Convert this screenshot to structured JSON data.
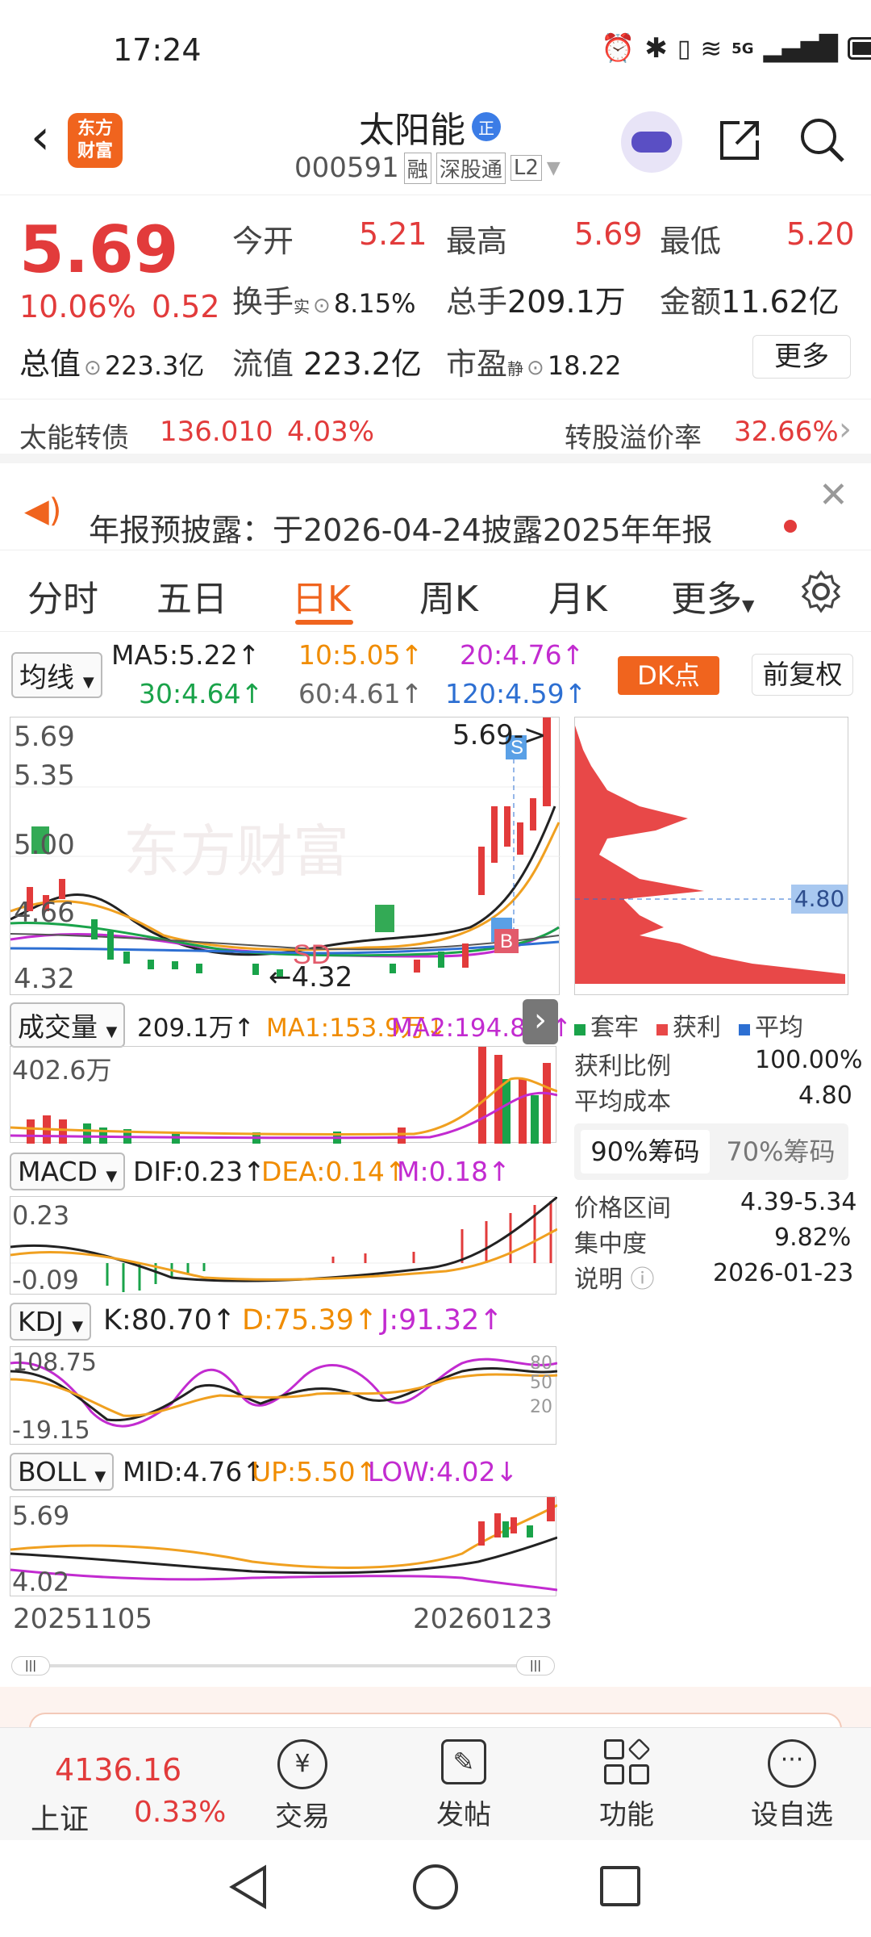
{
  "status": {
    "time": "17:24",
    "net": "5G"
  },
  "header": {
    "title": "太阳能",
    "badge": "正",
    "logo": "东方\n财富",
    "code": "000591",
    "tags": [
      "融",
      "深股通",
      "L2"
    ]
  },
  "quote": {
    "price": "5.69",
    "pct": "10.06%",
    "chg": "0.52",
    "open_label": "今开",
    "open": "5.21",
    "high_label": "最高",
    "high": "5.69",
    "low_label": "最低",
    "low": "5.20",
    "turnover_label": "换手",
    "turnover_sup": "实",
    "turnover": "8.15%",
    "vol_label": "总手",
    "vol": "209.1万",
    "amount_label": "金额",
    "amount": "11.62亿",
    "mktcap_label": "总值",
    "mktcap": "223.3亿",
    "float_label": "流值",
    "float": "223.2亿",
    "pe_label": "市盈",
    "pe_sup": "静",
    "pe": "18.22",
    "more": "更多"
  },
  "bond": {
    "name": "太能转债",
    "price": "136.010",
    "pct": "4.03%",
    "premium_label": "转股溢价率",
    "premium": "32.66%"
  },
  "notice": {
    "text": "年报预披露：于2026-04-24披露2025年年报"
  },
  "tabs": [
    "分时",
    "五日",
    "日K",
    "周K",
    "月K",
    "更多"
  ],
  "active_tab": "日K",
  "ma": {
    "selector": "均线",
    "ma5": "MA5:5.22↑",
    "ma10": "10:5.05↑",
    "ma20": "20:4.76↑",
    "ma30": "30:4.64↑",
    "ma60": "60:4.61↑",
    "ma120": "120:4.59↑",
    "dk": "DK点",
    "adjust": "前复权"
  },
  "kline": {
    "y_top": "5.69",
    "y2": "5.35",
    "y3": "5.00",
    "y4": "4.66",
    "y_bottom": "4.32",
    "high_marker": "5.69->",
    "low_marker": "4.32",
    "watermark": "东方财富"
  },
  "chips": {
    "avg_cost_marker": "4.80",
    "legend": [
      "套牢",
      "获利",
      "平均"
    ],
    "profit_label": "获利比例",
    "profit": "100.00%",
    "cost_label": "平均成本",
    "cost": "4.80",
    "tab90": "90%筹码",
    "tab70": "70%筹码",
    "range_label": "价格区间",
    "range": "4.39-5.34",
    "conc_label": "集中度",
    "conc": "9.82%",
    "note_label": "说明",
    "date": "2026-01-23"
  },
  "volume": {
    "selector": "成交量",
    "vol": "209.1万↑",
    "ma1": "MA1:153.9万↓",
    "ma2": "MA2:194.8万↑",
    "y_top": "402.6万"
  },
  "macd": {
    "selector": "MACD",
    "dif": "DIF:0.23↑",
    "dea": "DEA:0.14↑",
    "m": "M:0.18↑",
    "y_top": "0.23",
    "y_bottom": "-0.09"
  },
  "kdj": {
    "selector": "KDJ",
    "k": "K:80.70↑",
    "d": "D:75.39↑",
    "j": "J:91.32↑",
    "y_top": "108.75",
    "y_bottom": "-19.15",
    "r80": "80",
    "r50": "50",
    "r20": "20"
  },
  "boll": {
    "selector": "BOLL",
    "mid": "MID:4.76↑",
    "up": "UP:5.50↑",
    "low": "LOW:4.02↓",
    "y_top": "5.69",
    "y_bottom": "4.02"
  },
  "dates": {
    "start": "20251105",
    "end": "20260123"
  },
  "bottom": {
    "index_value": "4136.16",
    "index_name": "上证",
    "index_pct": "0.33%",
    "trade": "交易",
    "post": "发帖",
    "func": "功能",
    "watch": "设自选"
  }
}
